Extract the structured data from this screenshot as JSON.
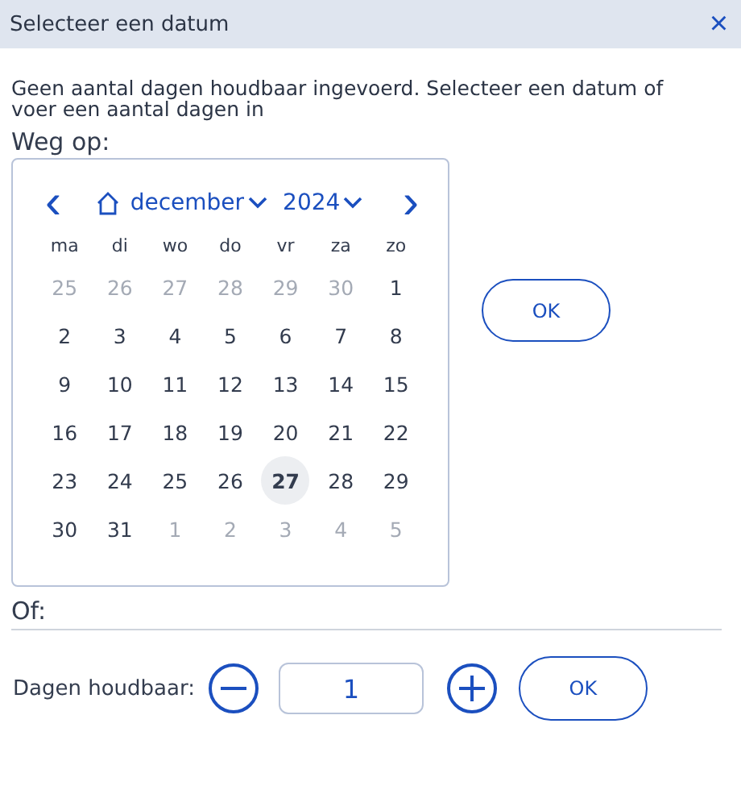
{
  "window": {
    "title": "Selecteer een datum",
    "close": "×"
  },
  "message": "Geen aantal dagen houdbaar ingevoerd. Selecteer een datum of voer een aantal dagen in",
  "date_label": "Weg op:",
  "calendar": {
    "prev": "‹",
    "month": "december",
    "year": "2024",
    "next": "›",
    "weekdays": [
      "ma",
      "di",
      "wo",
      "do",
      "vr",
      "za",
      "zo"
    ],
    "days": [
      {
        "label": "25",
        "outside": true,
        "selected": false
      },
      {
        "label": "26",
        "outside": true,
        "selected": false
      },
      {
        "label": "27",
        "outside": true,
        "selected": false
      },
      {
        "label": "28",
        "outside": true,
        "selected": false
      },
      {
        "label": "29",
        "outside": true,
        "selected": false
      },
      {
        "label": "30",
        "outside": true,
        "selected": false
      },
      {
        "label": "1",
        "outside": false,
        "selected": false
      },
      {
        "label": "2",
        "outside": false,
        "selected": false
      },
      {
        "label": "3",
        "outside": false,
        "selected": false
      },
      {
        "label": "4",
        "outside": false,
        "selected": false
      },
      {
        "label": "5",
        "outside": false,
        "selected": false
      },
      {
        "label": "6",
        "outside": false,
        "selected": false
      },
      {
        "label": "7",
        "outside": false,
        "selected": false
      },
      {
        "label": "8",
        "outside": false,
        "selected": false
      },
      {
        "label": "9",
        "outside": false,
        "selected": false
      },
      {
        "label": "10",
        "outside": false,
        "selected": false
      },
      {
        "label": "11",
        "outside": false,
        "selected": false
      },
      {
        "label": "12",
        "outside": false,
        "selected": false
      },
      {
        "label": "13",
        "outside": false,
        "selected": false
      },
      {
        "label": "14",
        "outside": false,
        "selected": false
      },
      {
        "label": "15",
        "outside": false,
        "selected": false
      },
      {
        "label": "16",
        "outside": false,
        "selected": false
      },
      {
        "label": "17",
        "outside": false,
        "selected": false
      },
      {
        "label": "18",
        "outside": false,
        "selected": false
      },
      {
        "label": "19",
        "outside": false,
        "selected": false
      },
      {
        "label": "20",
        "outside": false,
        "selected": false
      },
      {
        "label": "21",
        "outside": false,
        "selected": false
      },
      {
        "label": "22",
        "outside": false,
        "selected": false
      },
      {
        "label": "23",
        "outside": false,
        "selected": false
      },
      {
        "label": "24",
        "outside": false,
        "selected": false
      },
      {
        "label": "25",
        "outside": false,
        "selected": false
      },
      {
        "label": "26",
        "outside": false,
        "selected": false
      },
      {
        "label": "27",
        "outside": false,
        "selected": true
      },
      {
        "label": "28",
        "outside": false,
        "selected": false
      },
      {
        "label": "29",
        "outside": false,
        "selected": false
      },
      {
        "label": "30",
        "outside": false,
        "selected": false
      },
      {
        "label": "31",
        "outside": false,
        "selected": false
      },
      {
        "label": "1",
        "outside": true,
        "selected": false
      },
      {
        "label": "2",
        "outside": true,
        "selected": false
      },
      {
        "label": "3",
        "outside": true,
        "selected": false
      },
      {
        "label": "4",
        "outside": true,
        "selected": false
      },
      {
        "label": "5",
        "outside": true,
        "selected": false
      }
    ]
  },
  "date_ok": "OK",
  "or_label": "Of:",
  "days_label": "Dagen houdbaar:",
  "days_value": "1",
  "days_ok": "OK"
}
